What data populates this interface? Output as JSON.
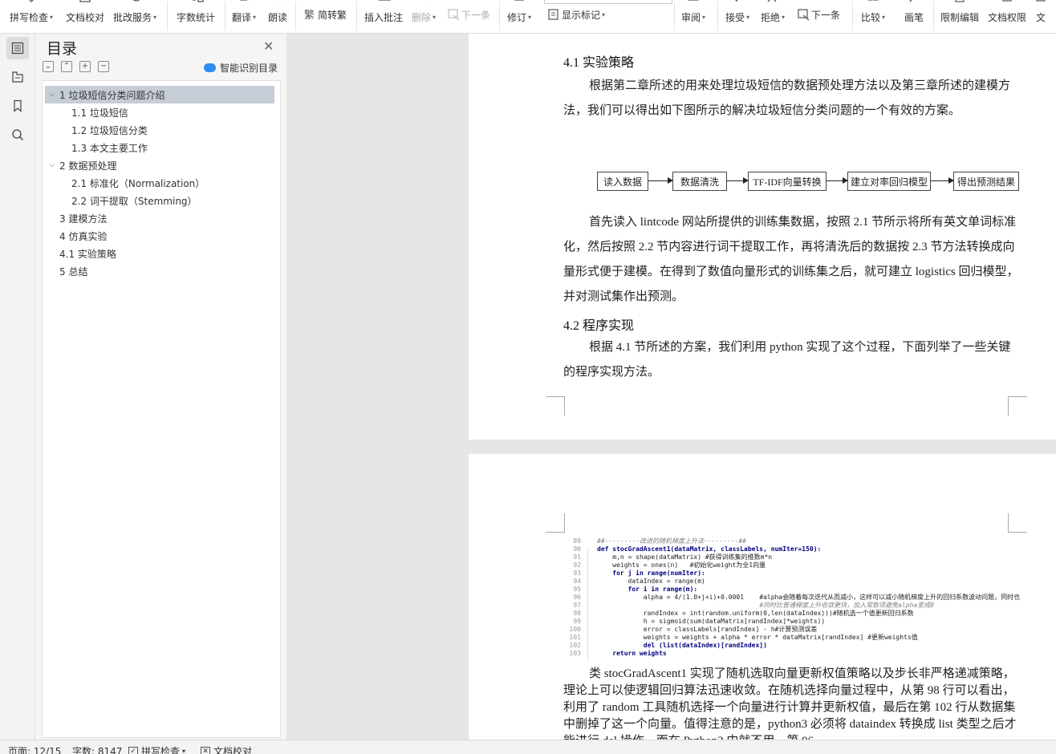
{
  "ribbon": {
    "spell_check": "拼写检查",
    "doc_proof": "文档校对",
    "approval_service": "批改服务",
    "word_count": "字数统计",
    "translate": "翻译",
    "read_aloud": "朗读",
    "trad_simp": "简转繁",
    "insert_comment": "插入批注",
    "delete": "删除",
    "next_item": "下一条",
    "revise": "修订",
    "show_marks": "显示标记",
    "review": "审阅",
    "accept": "接受",
    "reject": "拒绝",
    "next_change": "下一条",
    "compare": "比较",
    "pen": "画笔",
    "restrict_edit": "限制编辑",
    "doc_permission": "文档权限",
    "more": "文"
  },
  "toc": {
    "title": "目录",
    "smart_button": "智能识别目录",
    "items": [
      {
        "label": "1 垃圾短信分类问题介绍",
        "level": 1,
        "expanded": true,
        "selected": true
      },
      {
        "label": "1.1  垃圾短信",
        "level": 2
      },
      {
        "label": "1.2  垃圾短信分类",
        "level": 2
      },
      {
        "label": "1.3  本文主要工作",
        "level": 2
      },
      {
        "label": "2  数据预处理",
        "level": 1,
        "expanded": true
      },
      {
        "label": "2.1  标准化（Normalization）",
        "level": 2
      },
      {
        "label": "2.2  词干提取（Stemming）",
        "level": 2
      },
      {
        "label": "3  建模方法",
        "level": 1
      },
      {
        "label": "4  仿真实验",
        "level": 1
      },
      {
        "label": "4.1  实验策略",
        "level": 1
      },
      {
        "label": "5  总结",
        "level": 1
      }
    ]
  },
  "page1": {
    "heading_41": "4.1  实验策略",
    "para1": "根据第二章所述的用来处理垃圾短信的数据预处理方法以及第三章所述的建模方法，我们可以得出如下图所示的解决垃圾短信分类问题的一个有效的方案。",
    "flow": [
      "读入数据",
      "数据清洗",
      "TF-IDF向量转换",
      "建立对率回归模型",
      "得出预测结果"
    ],
    "para2": "首先读入 lintcode 网站所提供的训练集数据，按照 2.1 节所示将所有英文单词标准化，然后按照 2.2 节内容进行词干提取工作，再将清洗后的数据按 2.3 节方法转换成向量形式便于建模。在得到了数值向量形式的训练集之后，就可建立 logistics 回归模型，并对测试集作出预测。",
    "heading_42": "4.2  程序实现",
    "para3": "根据 4.1 节所述的方案，我们利用 python 实现了这个过程，下面列举了一些关键的程序实现方法。"
  },
  "code": {
    "lines": [
      {
        "n": "89",
        "t": "##---------改进的随机梯度上升法---------##"
      },
      {
        "n": "90",
        "t": "def stocGradAscent1(dataMatrix, classLabels, numIter=150):"
      },
      {
        "n": "91",
        "t": "    m,n = shape(dataMatrix) #获得训练集的维数m*n"
      },
      {
        "n": "92",
        "t": "    weights = ones(n)   #初始化weight为全1向量"
      },
      {
        "n": "93",
        "t": "    for j in range(numIter):"
      },
      {
        "n": "94",
        "t": "        dataIndex = range(m)"
      },
      {
        "n": "95",
        "t": "        for i in range(m):"
      },
      {
        "n": "96",
        "t": "            alpha = 4/(1.0+j+i)+0.0001    #alpha会随着每次迭代从而减小，这样可以减小随机梯度上升的回归系数波动问题，同时也"
      },
      {
        "n": "97",
        "t": "                                          #同时比普通梯度上升收敛更快，加入常数项避免alpha变成0"
      },
      {
        "n": "98",
        "t": "            randIndex = int(random.uniform(0,len(dataIndex)))#随机选一个值更新回归系数"
      },
      {
        "n": "99",
        "t": "            h = sigmoid(sum(dataMatrix[randIndex]*weights))"
      },
      {
        "n": "100",
        "t": "            error = classLabels[randIndex] - h#计算预测误差"
      },
      {
        "n": "101",
        "t": "            weights = weights + alpha * error * dataMatrix[randIndex] #更新weights值"
      },
      {
        "n": "102",
        "t": "            del (list(dataIndex)[randIndex])"
      },
      {
        "n": "103",
        "t": "    return weights"
      }
    ]
  },
  "page2": {
    "para": "类 stocGradAscent1 实现了随机选取向量更新权值策略以及步长非严格递减策略，理论上可以使逻辑回归算法迅速收敛。在随机选择向量过程中，从第 98 行可以看出，利用了 random 工具随机选择一个向量进行计算并更新权值，最后在第 102 行从数据集中删掉了这一个向量。值得注意的是，python3 必须将 dataindex 转换成 list 类型之后才能进行 del 操作，而在 Python2 中就不用，第 96"
  },
  "status": {
    "page": "页面: 12/15",
    "words": "字数: 8147",
    "spell": "拼写检查",
    "proof": "文档校对"
  }
}
